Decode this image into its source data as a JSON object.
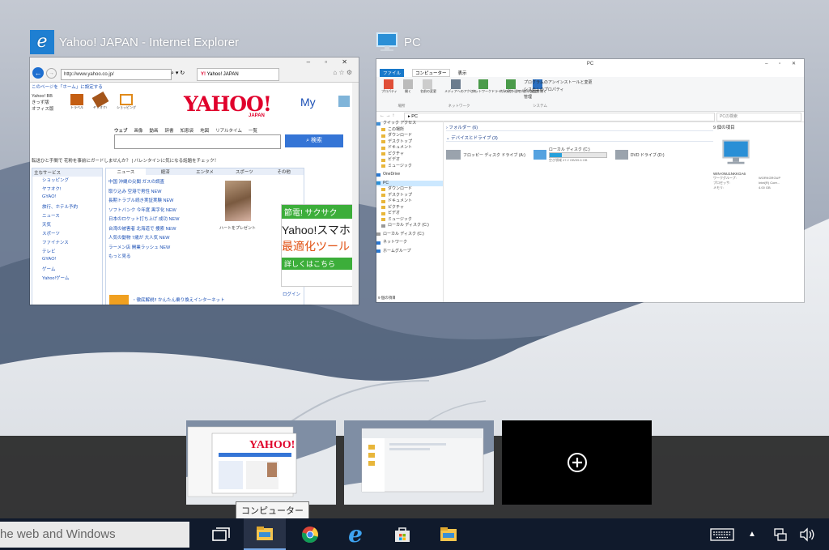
{
  "windows": {
    "ie": {
      "title": "Yahoo! JAPAN - Internet Explorer",
      "icon": "internet-explorer-icon",
      "address": "http://www.yahoo.co.jp/",
      "tab_label": "Yahoo! JAPAN",
      "logo": "YAHOO! JAPAN",
      "homepage_link": "このページを「ホーム」に設定する",
      "left_links": [
        "Yahoo! BB",
        "きっず版",
        "オフィス版"
      ],
      "top_icons": [
        "ショッピング",
        "ヤフオク!",
        "トラベル",
        "ショッピング"
      ],
      "search_tabs": [
        "ウェブ",
        "画像",
        "動画",
        "辞書",
        "知恵袋",
        "地図",
        "リアルタイム",
        "一覧"
      ],
      "search_button": "検索",
      "notice": "転送ひと手間で 花粉を事前にガードしませんか？ | バレンタインに気になる話題をチェック！",
      "services_header": "主なサービス",
      "services": [
        "ショッピング",
        "ヤフオク!",
        "GYAO!",
        "旅行、ホテル予約",
        "ニュース",
        "天気",
        "スポーツ",
        "ファイナンス",
        "テレビ",
        "GYAO!",
        "ゲーム",
        "Yahoo!ゲーム"
      ],
      "news_tabs": [
        "ニュース",
        "経済",
        "エンタメ",
        "スポーツ",
        "その他"
      ],
      "headlines": [
        "中国 沖縄の尖閣 ガスの調査",
        "取り込み 空港で男性 NEW",
        "長期トラブル続き実証実験 NEW",
        "ソフトバンク 今年度 黒字化 NEW",
        "日本のロケット打ち上げ 成功 NEW",
        "台湾の被害者 北海道で 捜索 NEW",
        "人気の動物 7歳が 大人気 NEW",
        "ラーメン店 開業ラッシュ NEW"
      ],
      "more_news": "もっと見る",
      "photo_caption": "ハートをプレゼント",
      "ad_text": "節電! サクサク",
      "ad_big": "Yahoo!スマホ",
      "ad_big2": "最適化ツール",
      "ad_button": "詳しくはこちら",
      "login": "ログイン",
      "bottom_text": "・徹底解説!! かんたん乗り換えインターネット"
    },
    "explorer": {
      "title": "PC",
      "icon": "pc-icon",
      "window_caption": "PC",
      "ribbon_tabs": [
        "ファイル",
        "コンピューター",
        "表示"
      ],
      "ribbon_groups": [
        "場所",
        "ネットワーク",
        "システム"
      ],
      "ribbon_buttons": [
        "プロパティ",
        "開く",
        "名前の変更",
        "メディアへのアクセス",
        "ネットワークドライブの割り当て",
        "ネットワークの場所の追加",
        "設定を開く"
      ],
      "ribbon_links": [
        "プログラムのアンインストールと変更",
        "システムのプロパティ",
        "管理"
      ],
      "address": "PC",
      "search_placeholder": "PCの検索",
      "sections": [
        "フォルダー (6)",
        "デバイスとドライブ (3)"
      ],
      "drives": [
        "フロッピー ディスク ドライブ (A:)",
        "ローカル ディスク (C:)",
        "DVD ドライブ (D:)"
      ],
      "drive_space": "空き領域 47.2 GB/59.6 GB",
      "nav_items": [
        "クイック アクセス",
        "この場所",
        "ダウンロード",
        "デスクトップ",
        "ドキュメント",
        "ピクチャ",
        "ビデオ",
        "ミュージック",
        "OneDrive",
        "PC",
        "ダウンロード",
        "デスクトップ",
        "ドキュメント",
        "ピクチャ",
        "ビデオ",
        "ミュージック",
        "ローカル ディスク (C:)",
        "ローカル ディスク (C:)",
        "ネットワーク",
        "ホームグループ"
      ],
      "item_count": "9 個の項目",
      "details_name": "WIN-0NU1NKKGA6",
      "details": [
        [
          "ワークグループ:",
          "WORKGROUP"
        ],
        [
          "プロセッサ:",
          "Intel(R) Core..."
        ],
        [
          "メモリ:",
          "4.00 GB"
        ]
      ],
      "status": "9 個の項目"
    }
  },
  "task_view": {
    "new_desktop_icon": "plus-circle-icon",
    "tooltip": "コンピューター"
  },
  "taskbar": {
    "search_text": "he web and Windows",
    "buttons": [
      "task-view-icon",
      "file-explorer-icon",
      "chrome-icon",
      "internet-explorer-icon",
      "store-icon",
      "file-explorer-icon"
    ],
    "tray": [
      "keyboard-icon",
      "chevron-up-icon",
      "network-icon",
      "volume-icon"
    ]
  }
}
